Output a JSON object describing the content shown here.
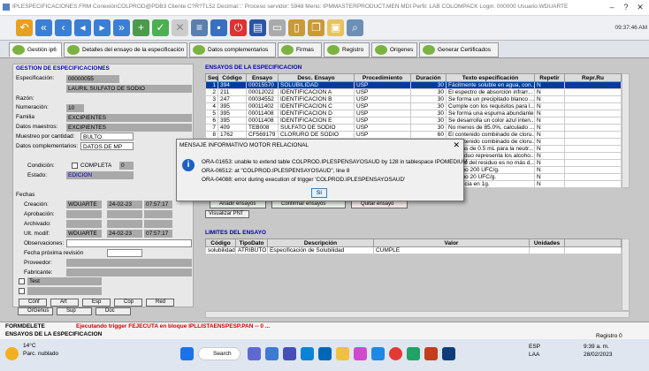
{
  "titlebar": {
    "text": "IPLESPECIFICACIONES.FRM     ConexiónCOLPROD@PDB3   Cliente C?R?TL52   Decimal:'.'   Proceso servidor: 5948   Menú: IPMMASTERPRODUCT.MEN  MDI   Perfil: LAB COLOMPACK Login: 000000   Usuario:WDUARTE",
    "min": "–",
    "max": "?",
    "close": "✕"
  },
  "toolbar": {
    "clock": "09:37:46 AM"
  },
  "tabs": [
    "Gestión ip6",
    "Detalles del ensayo de la especificación",
    "Datos complementarios",
    "Firmas",
    "Registro",
    "Origenes",
    "Generar Certificados"
  ],
  "left": {
    "section": "GESTION DE ESPECIFICACIONES",
    "especificacion_label": "Especificación:",
    "especificacion_value": "00000055",
    "descripcion_value": "LAURIL SULFATO DE SODIO",
    "razon_label": "Razón:",
    "numeracion_label": "Numeración:",
    "numeracion_value": "10",
    "familia_label": "Familia",
    "familia_value": "EXCIPIENTES",
    "datos_maestros_label": "Datos maestros:",
    "datos_maestros_value": "EXCIPIENTES",
    "muestreo_label": "Muestreo por cantidad:",
    "muestreo_value": "BULTO",
    "datos_compl_label": "Datos complementarios:",
    "datos_compl_value": "DATOS DE MP",
    "condicion_label": "Condición:",
    "condicion_value": "COMPLETA",
    "condicion_num": "0",
    "estado_label": "Estado:",
    "estado_value": "EDICION",
    "fechas_label": "Fechas",
    "creacion_label": "Creación:",
    "creacion_user": "WDUARTE",
    "creacion_date": "24-02-23",
    "creacion_time": "07:57:17",
    "aprobacion_label": "Aprobación:",
    "archivado_label": "Archivado:",
    "ult_label": "Ult. modif:",
    "ult_user": "WDUARTE",
    "ult_date": "24-02-23",
    "ult_time": "07:57:17",
    "observaciones_label": "Observaciones:",
    "fecha_prox_label": "Fecha próxima revisión",
    "proveedor_label": "Proveedor:",
    "fabricante_label": "Fabricante:",
    "test_value": "Test",
    "buttons_row1": [
      "Conf",
      "Art",
      "Esp",
      "Cop",
      "Red"
    ],
    "buttons_row2": [
      "OrGenus",
      "Sup",
      "Doc"
    ]
  },
  "grid": {
    "section": "ENSAYOS DE LA ESPECIFICACION",
    "headers": [
      "Seq",
      "Código",
      "Ensayo",
      "Desc. Ensayo",
      "Procedimiento",
      "Duración",
      "Texto especificación",
      "Repetir",
      "Repr.Ru"
    ],
    "rows": [
      [
        "1",
        "394",
        "00015570",
        "SOLUBILIDAD",
        "USP",
        "30",
        "Fácilmente soluble en agua, con...",
        "N",
        ""
      ],
      [
        "2",
        "211",
        "00012022",
        "IDENTIFICACIÓN A",
        "USP",
        "30",
        "El espectro de absorción infrarr...",
        "N",
        ""
      ],
      [
        "3",
        "247",
        "00034552",
        "IDENTIFICACIÓN B",
        "USP",
        "30",
        "Se forma un precipitado blanco ...",
        "N",
        ""
      ],
      [
        "4",
        "395",
        "00011402",
        "IDENTIFICACIÓN C",
        "USP",
        "30",
        "Cumple con los requisitos para l...",
        "N",
        ""
      ],
      [
        "5",
        "395",
        "00011408",
        "IDENTIFICACIÓN D",
        "USP",
        "30",
        "Se forma una espuma abundante.",
        "N",
        ""
      ],
      [
        "6",
        "395",
        "00011408",
        "IDENTIFICACIÓN E",
        "USP",
        "30",
        "Se desarrolla un color azul inten...",
        "N",
        ""
      ],
      [
        "7",
        "409",
        "TEB008",
        "SULFATO DE SODIO",
        "USP",
        "30",
        "No menos de 85.0%, calculado ...",
        "N",
        ""
      ],
      [
        "8",
        "1762",
        "CF569179",
        "CLORURO DE SODIO",
        "USP",
        "60",
        "El contenido combinado de cloru...",
        "N",
        ""
      ],
      [
        "9",
        "",
        "",
        "",
        "",
        "10",
        "El contenido combinado de cloru...",
        "N",
        ""
      ],
      [
        "10",
        "",
        "",
        "",
        "",
        "30",
        "No más de 0.5 mL para la neutr...",
        "N",
        ""
      ],
      [
        "11",
        "",
        "",
        "",
        "",
        "30",
        "El residuo representa los alcoho...",
        "N",
        ""
      ],
      [
        "12",
        "",
        "",
        "",
        "",
        "20",
        "El peso del residuo es no más d...",
        "N",
        ""
      ],
      [
        "13",
        "",
        "",
        "",
        "",
        "10",
        "Máximo 200 UFC/g.",
        "N",
        ""
      ],
      [
        "14",
        "",
        "",
        "",
        "",
        "10",
        "Máximo 20 UFC/g.",
        "N",
        ""
      ],
      [
        "15",
        "",
        "",
        "",
        "",
        "10",
        "Ausencia en 1g.",
        "N",
        ""
      ]
    ]
  },
  "grid_buttons": [
    "Añadir ensayos",
    "Confirmar ensayos",
    "Quitar ensayo"
  ],
  "visualizar_btn": "Visualizar PNT",
  "limites": {
    "section": "LIMITES DEL ENSAYO",
    "headers": [
      "Código",
      "TipoDato",
      "Descripción",
      "Valor",
      "Unidades"
    ],
    "row": [
      "solubilidad",
      "ATRIBUTO",
      "Especificación de Solubilidad",
      "CUMPLE",
      ""
    ]
  },
  "dialog": {
    "title": "MENSAJE INFORMATIVO MOTOR RELACIONAL",
    "close": "✕",
    "lines": [
      "ORA-01653: unable to extend table COLPROD.IPLESPENSAYOSAUD by 128 in tablespace IPOMEDIUM",
      "ORA-06512: at \"COLPROD.IPLESPENSAYOSAUD\", line 8",
      "ORA-04088: error during execution of trigger 'COLPROD.IPLESPENSAYOSAUD'"
    ],
    "ok": "Sí"
  },
  "status": {
    "formdelete": "FORMDELETE",
    "message": "Ejecutando trigger FEJECUTA en bloque IPLLISTAENSPESP.PAN -- 0 ...",
    "bottom": "ENSAYOS DE LA ESPECIFICACION",
    "registro": "Registro 0"
  },
  "taskbar": {
    "weather_temp": "14°C",
    "weather_desc": "Parc. nublado",
    "search": "Search",
    "lang": "ESP",
    "lang2": "LAA",
    "time": "9:39 a. m.",
    "date": "28/02/2023"
  },
  "colors": {
    "section_blue": "#0000b4",
    "status_red": "#d40000",
    "selection": "#003c9e"
  }
}
